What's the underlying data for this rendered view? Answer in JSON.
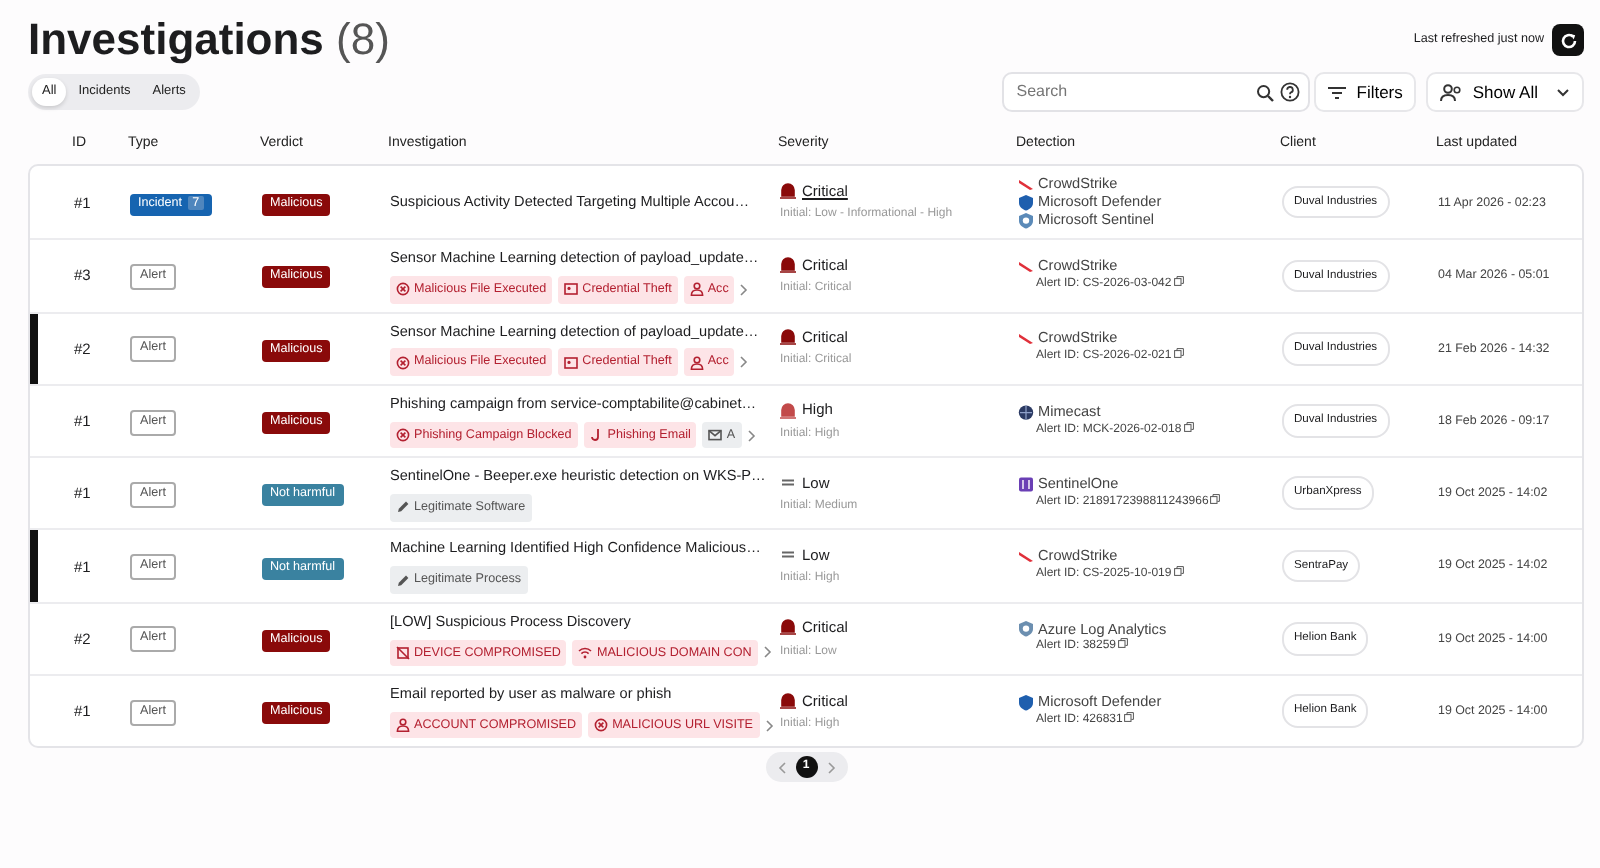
{
  "header": {
    "title": "Investigations",
    "count": "(8)",
    "refreshed": "Last refreshed just now"
  },
  "tabs": [
    {
      "label": "All",
      "selected": true
    },
    {
      "label": "Incidents",
      "selected": false
    },
    {
      "label": "Alerts",
      "selected": false
    }
  ],
  "search": {
    "placeholder": "Search"
  },
  "buttons": {
    "filters": "Filters",
    "show": "Show All"
  },
  "table": {
    "columns": [
      "ID",
      "Type",
      "Verdict",
      "Investigation",
      "Severity",
      "Detection",
      "Client",
      "Last updated"
    ],
    "rows": [
      {
        "marked": false,
        "id": "#1",
        "type": {
          "kind": "incident",
          "label": "Incident",
          "count": "7"
        },
        "verdict": {
          "kind": "malicious",
          "label": "Malicious"
        },
        "title": "Suspicious Activity Detected Targeting Multiple Accou…",
        "tags": [],
        "severity": {
          "kind": "critical",
          "label": "Critical",
          "underlined": true,
          "initial": "Initial: Low - Informational - High"
        },
        "sources": [
          {
            "kind": "crowdstrike",
            "name": "CrowdStrike"
          },
          {
            "kind": "defender",
            "name": "Microsoft Defender"
          },
          {
            "kind": "sentinel",
            "name": "Microsoft Sentinel"
          }
        ],
        "client": "Duval Industries",
        "updated": "11 Apr 2026 - 02:23"
      },
      {
        "marked": false,
        "id": "#3",
        "type": {
          "kind": "alert",
          "label": "Alert"
        },
        "verdict": {
          "kind": "malicious",
          "label": "Malicious"
        },
        "title": "Sensor Machine Learning detection of payload_update…",
        "tags": [
          {
            "kind": "x-circle",
            "color": "#b32030",
            "label": "Malicious File Executed"
          },
          {
            "kind": "card",
            "color": "#b32030",
            "label": "Credential Theft"
          },
          {
            "kind": "person",
            "color": "#b32030",
            "label": "Acc"
          }
        ],
        "severity": {
          "kind": "critical",
          "label": "Critical",
          "underlined": false,
          "initial": "Initial: Critical"
        },
        "sources": [
          {
            "kind": "crowdstrike",
            "name": "CrowdStrike"
          }
        ],
        "alert_id": "Alert ID: CS-2026-03-042",
        "client": "Duval Industries",
        "updated": "04 Mar 2026 - 05:01"
      },
      {
        "marked": true,
        "id": "#2",
        "type": {
          "kind": "alert",
          "label": "Alert"
        },
        "verdict": {
          "kind": "malicious",
          "label": "Malicious"
        },
        "title": "Sensor Machine Learning detection of payload_update…",
        "tags": [
          {
            "kind": "x-circle",
            "color": "#b32030",
            "label": "Malicious File Executed"
          },
          {
            "kind": "card",
            "color": "#b32030",
            "label": "Credential Theft"
          },
          {
            "kind": "person",
            "color": "#b32030",
            "label": "Acc"
          }
        ],
        "severity": {
          "kind": "critical",
          "label": "Critical",
          "underlined": false,
          "initial": "Initial: Critical"
        },
        "sources": [
          {
            "kind": "crowdstrike",
            "name": "CrowdStrike"
          }
        ],
        "alert_id": "Alert ID: CS-2026-02-021",
        "client": "Duval Industries",
        "updated": "21 Feb 2026 - 14:32"
      },
      {
        "marked": false,
        "id": "#1",
        "type": {
          "kind": "alert",
          "label": "Alert"
        },
        "verdict": {
          "kind": "malicious",
          "label": "Malicious"
        },
        "title": "Phishing campaign from service-comptabilite@cabinet…",
        "tags": [
          {
            "kind": "x-circle",
            "color": "#b32030",
            "label": "Phishing Campaign Blocked"
          },
          {
            "kind": "hook",
            "color": "#b32030",
            "label": "Phishing Email"
          },
          {
            "kind": "mail",
            "color": "#555555",
            "label": "A"
          }
        ],
        "severity": {
          "kind": "high",
          "label": "High",
          "underlined": false,
          "initial": "Initial: High"
        },
        "sources": [
          {
            "kind": "mimecast",
            "name": "Mimecast"
          }
        ],
        "alert_id": "Alert ID: MCK-2026-02-018",
        "client": "Duval Industries",
        "updated": "18 Feb 2026 - 09:17"
      },
      {
        "marked": false,
        "id": "#1",
        "type": {
          "kind": "alert",
          "label": "Alert"
        },
        "verdict": {
          "kind": "benign",
          "label": "Not harmful"
        },
        "title": "SentinelOne - Beeper.exe heuristic detection on WKS-P…",
        "tags": [
          {
            "kind": "pencil",
            "color": "#555555",
            "label": "Legitimate Software"
          }
        ],
        "severity": {
          "kind": "low",
          "label": "Low",
          "underlined": false,
          "initial": "Initial: Medium"
        },
        "sources": [
          {
            "kind": "sentinelone",
            "name": "SentinelOne"
          }
        ],
        "alert_id": "Alert ID: 2189172398811243966",
        "client": "UrbanXpress",
        "updated": "19 Oct 2025 - 14:02"
      },
      {
        "marked": true,
        "id": "#1",
        "type": {
          "kind": "alert",
          "label": "Alert"
        },
        "verdict": {
          "kind": "benign",
          "label": "Not harmful"
        },
        "title": "Machine Learning Identified High Confidence Malicious…",
        "tags": [
          {
            "kind": "pencil",
            "color": "#555555",
            "label": "Legitimate Process"
          }
        ],
        "severity": {
          "kind": "low",
          "label": "Low",
          "underlined": false,
          "initial": "Initial: High"
        },
        "sources": [
          {
            "kind": "crowdstrike",
            "name": "CrowdStrike"
          }
        ],
        "alert_id": "Alert ID: CS-2025-10-019",
        "client": "SentraPay",
        "updated": "19 Oct 2025 - 14:02"
      },
      {
        "marked": false,
        "id": "#2",
        "type": {
          "kind": "alert",
          "label": "Alert"
        },
        "verdict": {
          "kind": "malicious",
          "label": "Malicious"
        },
        "title": "[LOW] Suspicious Process Discovery",
        "tags": [
          {
            "kind": "device",
            "color": "#b32030",
            "label": "DEVICE COMPROMISED"
          },
          {
            "kind": "wifi",
            "color": "#b32030",
            "label": "MALICIOUS DOMAIN CON"
          }
        ],
        "severity": {
          "kind": "critical",
          "label": "Critical",
          "underlined": false,
          "initial": "Initial: Low"
        },
        "sources": [
          {
            "kind": "azure",
            "name": "Azure Log Analytics"
          }
        ],
        "alert_id": "Alert ID: 38259",
        "client": "Helion Bank",
        "updated": "19 Oct 2025 - 14:00"
      },
      {
        "marked": false,
        "id": "#1",
        "type": {
          "kind": "alert",
          "label": "Alert"
        },
        "verdict": {
          "kind": "malicious",
          "label": "Malicious"
        },
        "title": "Email reported by user as malware or phish",
        "tags": [
          {
            "kind": "person",
            "color": "#b32030",
            "label": "ACCOUNT COMPROMISED"
          },
          {
            "kind": "x-circle",
            "color": "#b32030",
            "label": "MALICIOUS URL VISITE"
          }
        ],
        "severity": {
          "kind": "critical",
          "label": "Critical",
          "underlined": false,
          "initial": "Initial: High"
        },
        "sources": [
          {
            "kind": "defender",
            "name": "Microsoft Defender"
          }
        ],
        "alert_id": "Alert ID: 426831",
        "client": "Helion Bank",
        "updated": "19 Oct 2025 - 14:00"
      }
    ]
  },
  "pagination": {
    "pages": [
      {
        "label": "1",
        "selected": true
      }
    ]
  }
}
